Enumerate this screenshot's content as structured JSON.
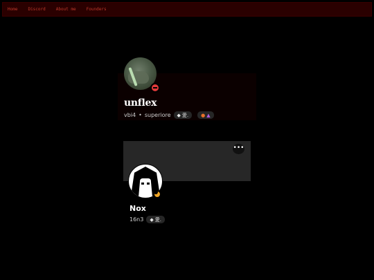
{
  "nav": {
    "items": [
      {
        "label": "Home"
      },
      {
        "label": "Discord"
      },
      {
        "label": "About me"
      },
      {
        "label": "Founders"
      }
    ]
  },
  "profile1": {
    "name": "unflex",
    "handle": "vbi4",
    "separator": "•",
    "tagline": "superiore",
    "badge1_text": "愛.",
    "badge1_icon": "gem-icon",
    "badge2_icons": [
      "fire-icon",
      "triangle-icon"
    ],
    "status": "do-not-disturb",
    "status_color": "#e03a3a"
  },
  "profile2": {
    "name": "Nox",
    "handle": "16n3",
    "badge1_text": "愛.",
    "badge1_icon": "gem-icon",
    "status": "idle",
    "status_color": "#f0a526",
    "menu_icon": "more-icon"
  },
  "colors": {
    "background": "#000000",
    "nav_bg": "#2a0000",
    "nav_text": "#c0392b",
    "banner2": "#272727",
    "chip_bg": "#262626"
  }
}
